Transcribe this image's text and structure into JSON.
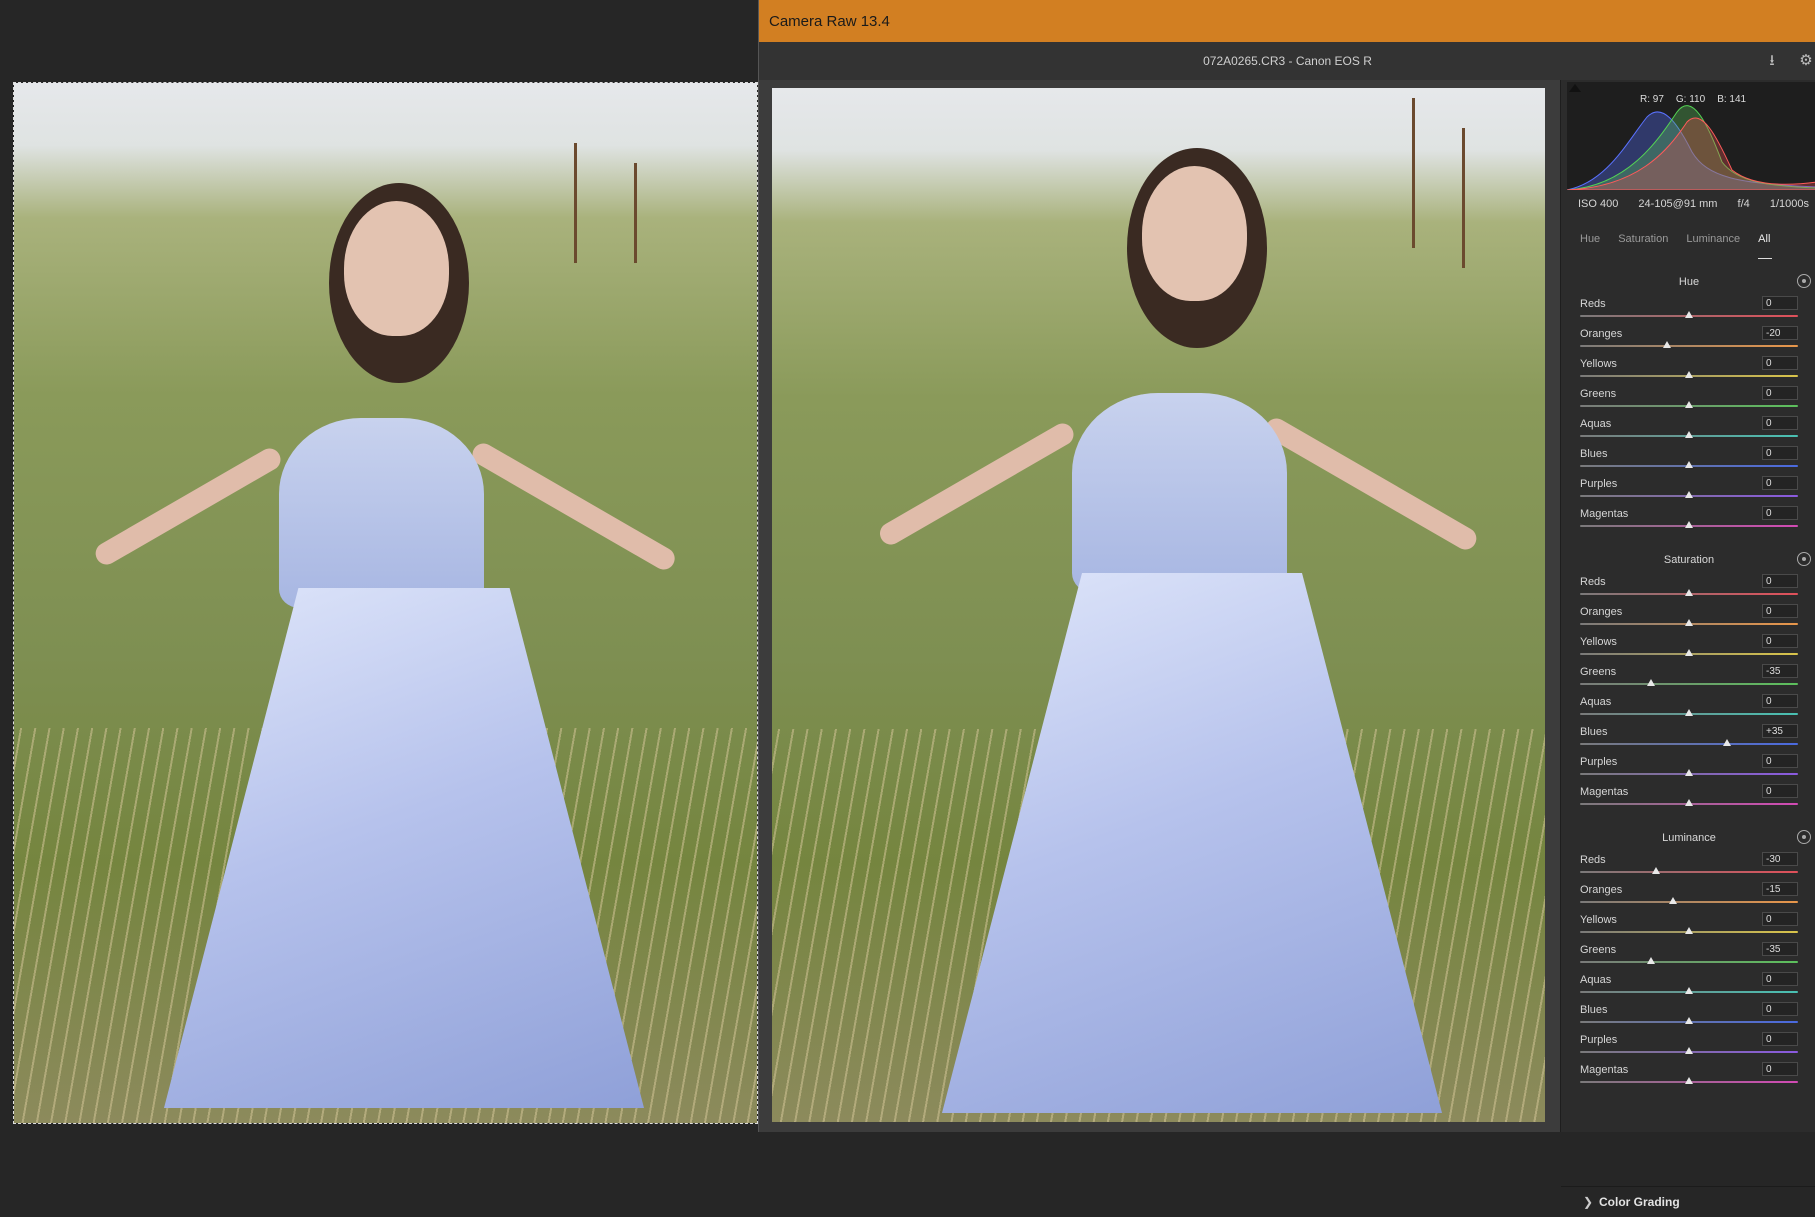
{
  "app": {
    "window_title": "Camera Raw 13.4",
    "file_info": "072A0265.CR3  -  Canon EOS R",
    "icons": [
      "save-icon",
      "gear-icon"
    ]
  },
  "histogram": {
    "readout": {
      "r": "R: 97",
      "g": "G: 110",
      "b": "B: 141"
    }
  },
  "exif": {
    "iso": "ISO 400",
    "lens": "24-105@91 mm",
    "aperture": "f/4",
    "shutter": "1/1000s"
  },
  "hsl_tabs": [
    "Hue",
    "Saturation",
    "Luminance",
    "All"
  ],
  "active_tab": "All",
  "sections": [
    {
      "title": "Hue",
      "sliders": [
        {
          "label": "Reds",
          "value": "0"
        },
        {
          "label": "Oranges",
          "value": "-20"
        },
        {
          "label": "Yellows",
          "value": "0"
        },
        {
          "label": "Greens",
          "value": "0"
        },
        {
          "label": "Aquas",
          "value": "0"
        },
        {
          "label": "Blues",
          "value": "0"
        },
        {
          "label": "Purples",
          "value": "0"
        },
        {
          "label": "Magentas",
          "value": "0"
        }
      ]
    },
    {
      "title": "Saturation",
      "sliders": [
        {
          "label": "Reds",
          "value": "0"
        },
        {
          "label": "Oranges",
          "value": "0"
        },
        {
          "label": "Yellows",
          "value": "0"
        },
        {
          "label": "Greens",
          "value": "-35"
        },
        {
          "label": "Aquas",
          "value": "0"
        },
        {
          "label": "Blues",
          "value": "+35"
        },
        {
          "label": "Purples",
          "value": "0"
        },
        {
          "label": "Magentas",
          "value": "0"
        }
      ]
    },
    {
      "title": "Luminance",
      "sliders": [
        {
          "label": "Reds",
          "value": "-30"
        },
        {
          "label": "Oranges",
          "value": "-15"
        },
        {
          "label": "Yellows",
          "value": "0"
        },
        {
          "label": "Greens",
          "value": "-35"
        },
        {
          "label": "Aquas",
          "value": "0"
        },
        {
          "label": "Blues",
          "value": "0"
        },
        {
          "label": "Purples",
          "value": "0"
        },
        {
          "label": "Magentas",
          "value": "0"
        }
      ]
    }
  ],
  "collapsed_panel": "Color Grading",
  "colors": {
    "titlebar": "#d27f22",
    "Reds": "#e0505a",
    "Oranges": "#e8964a",
    "Yellows": "#d9c44a",
    "Greens": "#5cc05c",
    "Aquas": "#49c1b3",
    "Blues": "#4a6ae0",
    "Purples": "#8a5ae0",
    "Magentas": "#d24ab4"
  }
}
